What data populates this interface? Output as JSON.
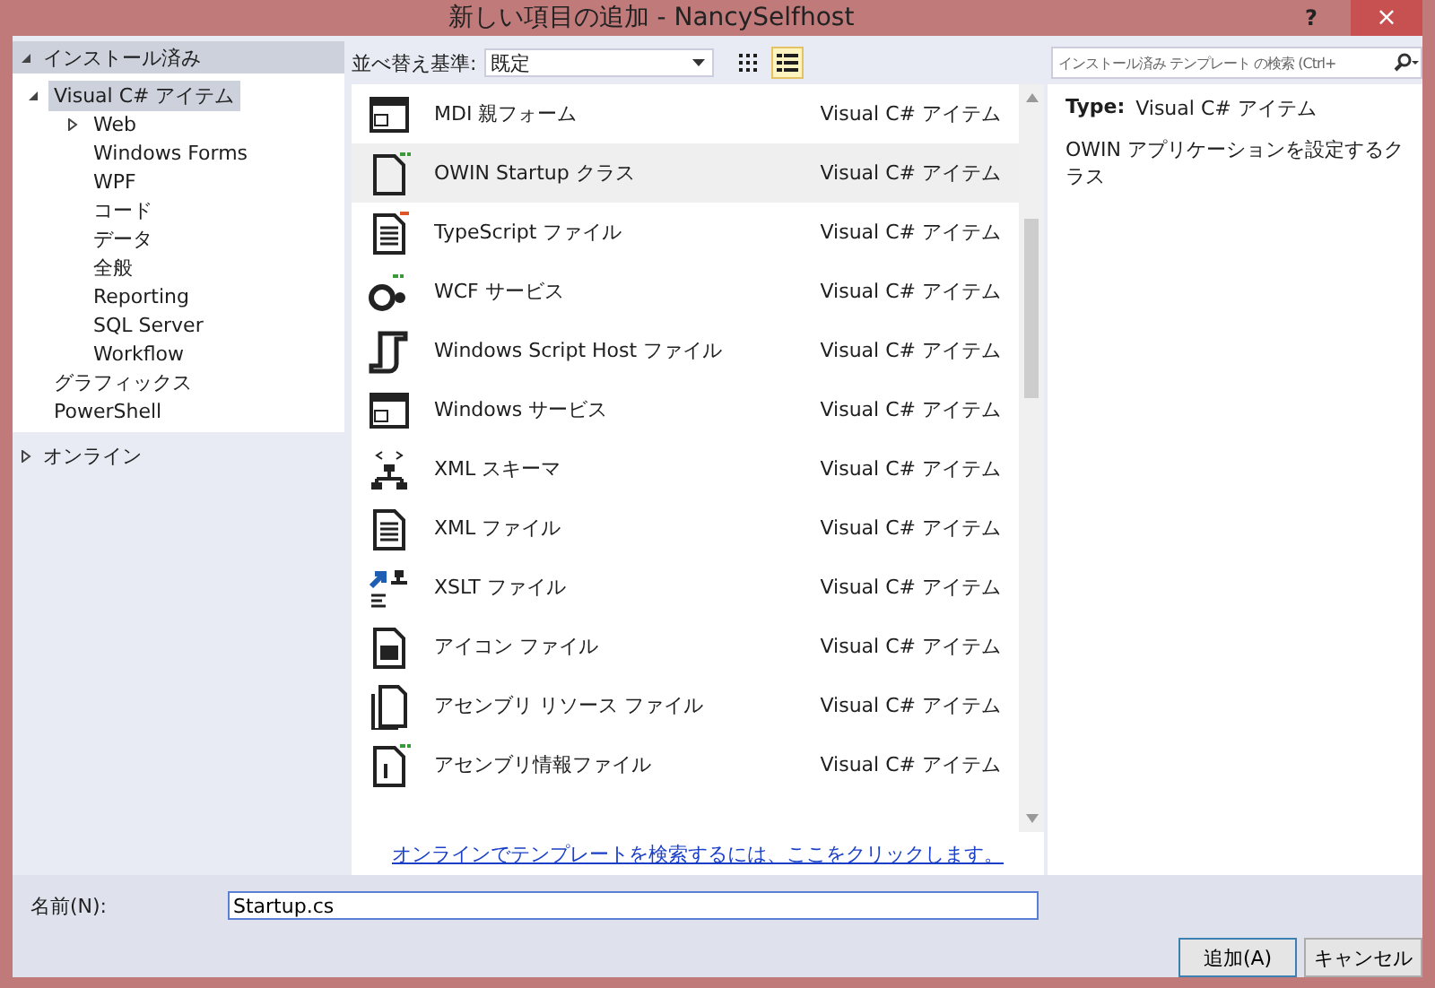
{
  "window": {
    "title": "新しい項目の追加 - NancySelfhost",
    "help": "?",
    "close": "×"
  },
  "sidebar": {
    "sections": [
      {
        "label": "インストール済み",
        "expanded": true,
        "children": [
          {
            "label": "Visual C# アイテム",
            "expanded": true,
            "selected": true,
            "children": [
              {
                "label": "Web",
                "expanded": false,
                "selected": false
              },
              {
                "label": "Windows Forms",
                "selected": false
              },
              {
                "label": "WPF",
                "selected": false
              },
              {
                "label": "コード",
                "selected": false
              },
              {
                "label": "データ",
                "selected": false
              },
              {
                "label": "全般",
                "selected": false
              },
              {
                "label": "Reporting",
                "selected": false
              },
              {
                "label": "SQL Server",
                "selected": false
              },
              {
                "label": "Workflow",
                "selected": false
              }
            ]
          },
          {
            "label": "グラフィックス",
            "selected": false
          },
          {
            "label": "PowerShell",
            "selected": false
          }
        ]
      },
      {
        "label": "オンライン",
        "expanded": false
      }
    ]
  },
  "toolbar": {
    "sort_label": "並べ替え基準:",
    "sort_value": "既定",
    "views": [
      {
        "kind": "grid",
        "selected": false
      },
      {
        "kind": "list",
        "selected": true
      }
    ]
  },
  "search": {
    "placeholder": "インストール済み テンプレート の検索 (Ctrl+"
  },
  "templates": [
    {
      "name": "MDI 親フォーム",
      "type": "Visual C# アイテム",
      "selected": false
    },
    {
      "name": "OWIN Startup クラス",
      "type": "Visual C# アイテム",
      "selected": true
    },
    {
      "name": "TypeScript ファイル",
      "type": "Visual C# アイテム",
      "selected": false
    },
    {
      "name": "WCF サービス",
      "type": "Visual C# アイテム",
      "selected": false
    },
    {
      "name": "Windows Script Host ファイル",
      "type": "Visual C# アイテム",
      "selected": false
    },
    {
      "name": "Windows サービス",
      "type": "Visual C# アイテム",
      "selected": false
    },
    {
      "name": "XML スキーマ",
      "type": "Visual C# アイテム",
      "selected": false
    },
    {
      "name": "XML ファイル",
      "type": "Visual C# アイテム",
      "selected": false
    },
    {
      "name": "XSLT ファイル",
      "type": "Visual C# アイテム",
      "selected": false
    },
    {
      "name": "アイコン ファイル",
      "type": "Visual C# アイテム",
      "selected": false
    },
    {
      "name": "アセンブリ リソース ファイル",
      "type": "Visual C# アイテム",
      "selected": false
    },
    {
      "name": "アセンブリ情報ファイル",
      "type": "Visual C# アイテム",
      "selected": false
    }
  ],
  "online_link": "オンラインでテンプレートを検索するには、ここをクリックします。",
  "details": {
    "type_label": "Type:",
    "type_value": "Visual C# アイテム",
    "description": "OWIN アプリケーションを設定するクラス"
  },
  "name_field": {
    "label": "名前(N):",
    "value": "Startup.cs"
  },
  "buttons": [
    "追加(A)",
    "キャンセル"
  ]
}
